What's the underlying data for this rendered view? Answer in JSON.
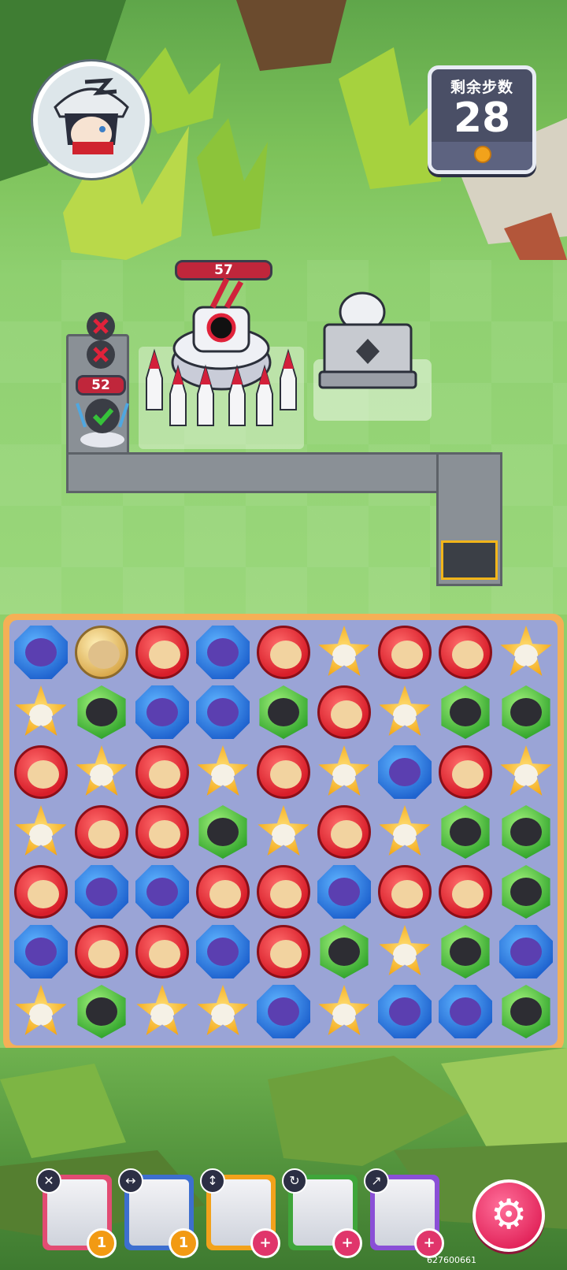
{
  "hud": {
    "moves_label": "剩余步数",
    "moves_value": "28"
  },
  "enemies": {
    "boss_hp": "57",
    "minion_hp": "52"
  },
  "board": {
    "rows": [
      [
        "blue",
        "gold",
        "red",
        "blue",
        "red",
        "star",
        "red",
        "red",
        "star"
      ],
      [
        "star",
        "green",
        "blue",
        "blue",
        "green",
        "red",
        "star",
        "green",
        "green"
      ],
      [
        "red",
        "star",
        "red",
        "star",
        "red",
        "star",
        "blue",
        "red",
        "star"
      ],
      [
        "star",
        "red",
        "red",
        "green",
        "star",
        "red",
        "star",
        "green",
        "green"
      ],
      [
        "red",
        "blue",
        "blue",
        "red",
        "red",
        "blue",
        "red",
        "red",
        "green"
      ],
      [
        "blue",
        "red",
        "red",
        "blue",
        "red",
        "green",
        "star",
        "green",
        "blue"
      ],
      [
        "star",
        "green",
        "star",
        "star",
        "blue",
        "star",
        "blue",
        "blue",
        "green"
      ]
    ]
  },
  "heroes": [
    {
      "ability_icon": "✕",
      "badge": "1",
      "badge_type": "orange",
      "color": "#e24c73"
    },
    {
      "ability_icon": "↔",
      "badge": "1",
      "badge_type": "orange",
      "color": "#3d6fcf"
    },
    {
      "ability_icon": "↕",
      "badge": "+",
      "badge_type": "pink",
      "color": "#f2a21b"
    },
    {
      "ability_icon": "↻",
      "badge": "+",
      "badge_type": "pink",
      "color": "#3fa53a"
    },
    {
      "ability_icon": "↗",
      "badge": "+",
      "badge_type": "pink",
      "color": "#8a4fd6"
    }
  ],
  "settings_icon": "⚙",
  "user_id": "627600661"
}
